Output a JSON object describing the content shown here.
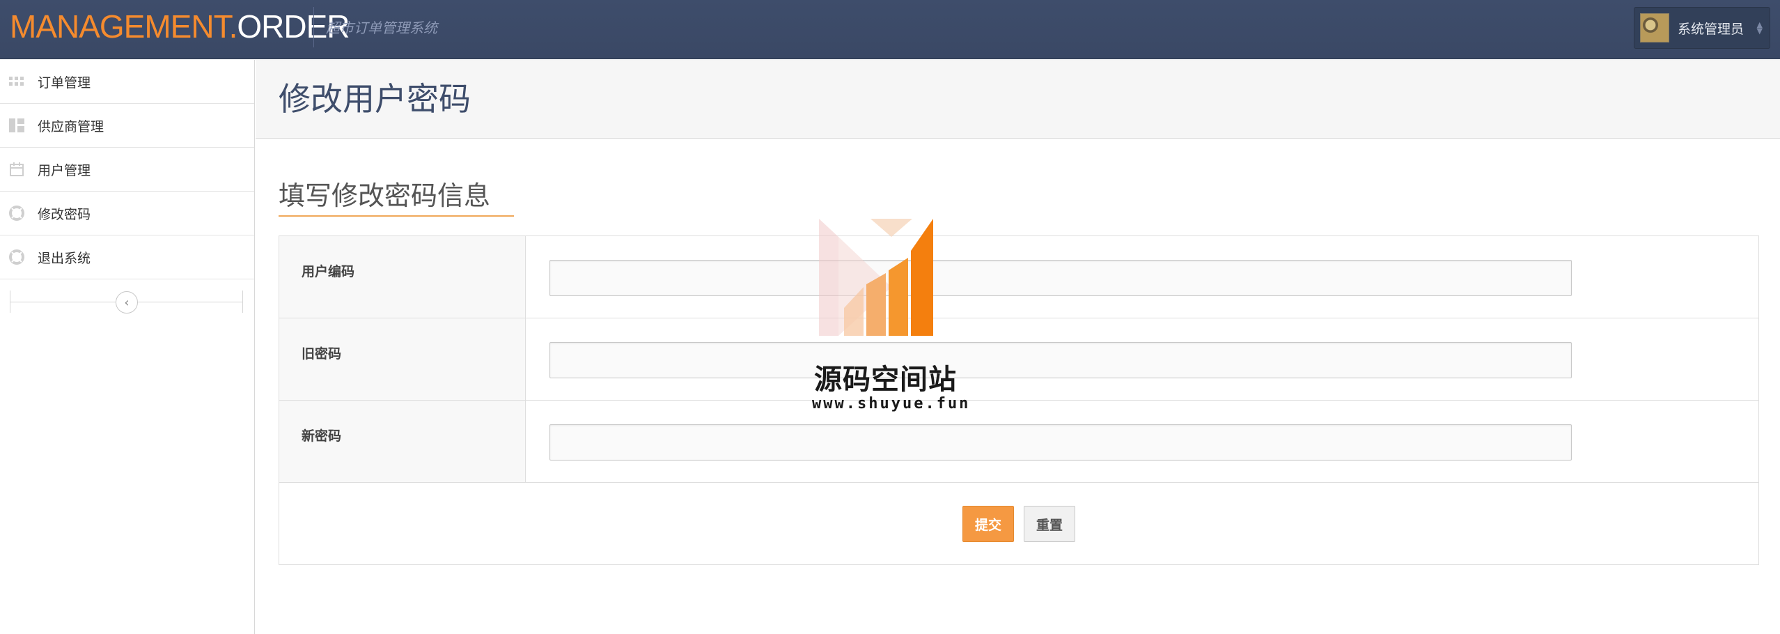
{
  "header": {
    "brand_part1": "MANAGEMENT.",
    "brand_part2": "ORDER",
    "subtitle": "超市订单管理系统",
    "user_name": "系统管理员",
    "colors": {
      "bar": "#3e4d6b",
      "accent": "#f58b2e"
    }
  },
  "sidebar": {
    "items": [
      {
        "label": "订单管理",
        "icon": "grid-icon"
      },
      {
        "label": "供应商管理",
        "icon": "dashboard-icon"
      },
      {
        "label": "用户管理",
        "icon": "calendar-icon"
      },
      {
        "label": "修改密码",
        "icon": "life-ring-icon"
      },
      {
        "label": "退出系统",
        "icon": "life-ring-icon"
      }
    ],
    "collapse_icon": "chevron-left-icon"
  },
  "main": {
    "page_title": "修改用户密码",
    "section_title": "填写修改密码信息",
    "fields": [
      {
        "label": "用户编码",
        "value": ""
      },
      {
        "label": "旧密码",
        "value": ""
      },
      {
        "label": "新密码",
        "value": ""
      }
    ],
    "submit_label": "提交",
    "reset_label": "重置"
  },
  "watermark": {
    "title": "源码空间站",
    "url": "www.shuyue.fun"
  }
}
